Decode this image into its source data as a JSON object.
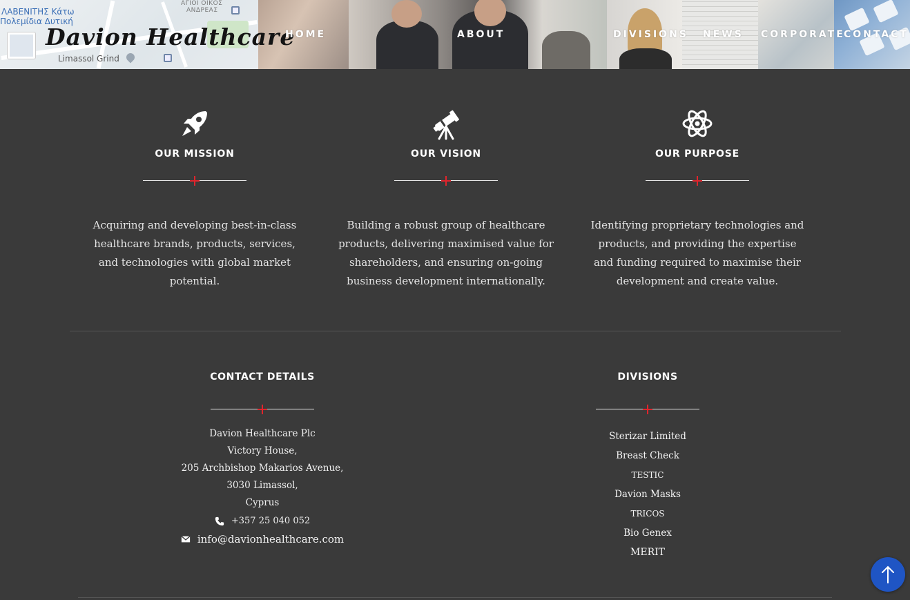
{
  "brand": {
    "logo_text": "Davion Healthcare"
  },
  "header": {
    "map_labels": [
      "ΛΑΒΕΝΙΤΗΣ Κάτω",
      "Πολεμίδια Δυτική",
      "ΑΓΙΟΙ ΟΙΚΟΣ",
      "ΑΝΔΡΕΑΣ",
      "Limassol Grind"
    ]
  },
  "nav": {
    "items": [
      {
        "label": "HOME"
      },
      {
        "label": "ABOUT"
      },
      {
        "label": "DIVISIONS"
      },
      {
        "label": "NEWS"
      },
      {
        "label": "CORPORATE"
      },
      {
        "label": "CONTACT"
      }
    ]
  },
  "values": [
    {
      "icon": "rocket-icon",
      "title": "OUR MISSION",
      "text": "Acquiring and developing best-in-class healthcare brands, products, services, and technologies with global market potential."
    },
    {
      "icon": "telescope-icon",
      "title": "OUR VISION",
      "text": "Building a robust group of healthcare products, delivering maximised value for shareholders, and ensuring on-going business development internationally."
    },
    {
      "icon": "atom-icon",
      "title": "OUR PURPOSE",
      "text": "Identifying proprietary technologies and products, and providing the expertise and funding required to maximise their development and create value."
    }
  ],
  "footer": {
    "contact": {
      "title": "CONTACT DETAILS",
      "address_lines": [
        "Davion Healthcare Plc",
        "Victory House,",
        "205 Archbishop Makarios Avenue,",
        "3030 Limassol,",
        "Cyprus"
      ],
      "phone": "+357 25 040 052",
      "email": "info@davionhealthcare.com"
    },
    "divisions": {
      "title": "DIVISIONS",
      "items": [
        "Sterizar Limited",
        "Breast Check",
        "TESTIC",
        "Davion Masks",
        "TRICOS",
        "Bio Genex",
        "MERIT"
      ]
    }
  },
  "colors": {
    "accent_red": "#e0242c",
    "background": "#3a3a3a",
    "scroll_button": "#1f55c4"
  },
  "scroll_top_icon": "arrow-up-icon"
}
